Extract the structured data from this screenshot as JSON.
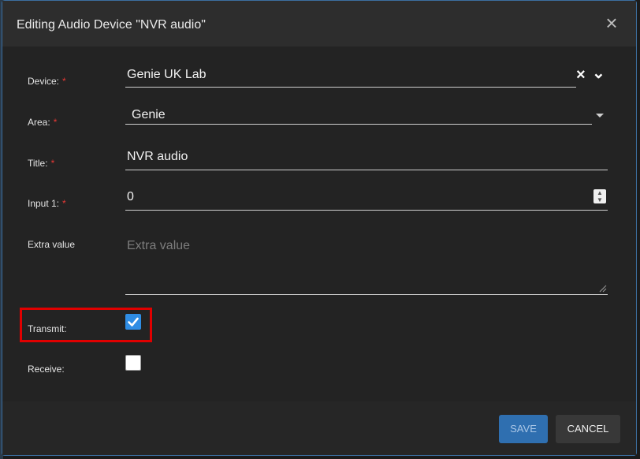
{
  "dialog": {
    "title": "Editing Audio Device \"NVR audio\"",
    "close_icon": "×"
  },
  "form": {
    "required_marker": "*",
    "device": {
      "label": "Device:",
      "value": "Genie UK Lab",
      "clear_icon": "×",
      "expand_icon": "⌄"
    },
    "area": {
      "label": "Area:",
      "value": "Genie"
    },
    "title": {
      "label": "Title:",
      "value": "NVR audio"
    },
    "input1": {
      "label": "Input 1:",
      "value": "0"
    },
    "extra_value": {
      "label": "Extra value",
      "placeholder": "Extra value"
    },
    "transmit": {
      "label": "Transmit:",
      "checked": true,
      "check_glyph": "✔"
    },
    "receive": {
      "label": "Receive:",
      "checked": false
    }
  },
  "footer": {
    "save_label": "SAVE",
    "cancel_label": "CANCEL"
  },
  "colors": {
    "accent": "#2f8de4",
    "save_button": "#2f6fb0",
    "required": "#e53935",
    "highlight": "#e00000"
  }
}
